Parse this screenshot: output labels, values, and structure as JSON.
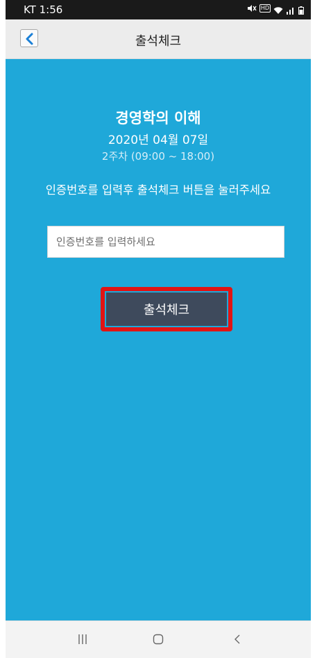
{
  "status_bar": {
    "carrier_time": "KT 1:56",
    "icons": [
      "mute-icon",
      "hd-icon",
      "wifi-icon",
      "signal-icon",
      "battery-icon"
    ],
    "hd_label": "HD"
  },
  "header": {
    "title": "출석체크",
    "back_icon": "chevron-left-icon"
  },
  "course": {
    "title": "경영학의 이해",
    "date": "2020년 04월 07일",
    "session": "2주차 (09:00 ~ 18:00)"
  },
  "instruction": "인증번호를 입력후 출석체크 버튼을 눌러주세요",
  "code_input": {
    "placeholder": "인증번호를 입력하세요",
    "value": ""
  },
  "check_button": {
    "label": "출석체크"
  },
  "nav_bar": {
    "icons": [
      "recents-icon",
      "home-icon",
      "back-icon"
    ]
  },
  "colors": {
    "background": "#1fa8d9",
    "button": "#3e4a5c",
    "highlight": "#e11414"
  }
}
